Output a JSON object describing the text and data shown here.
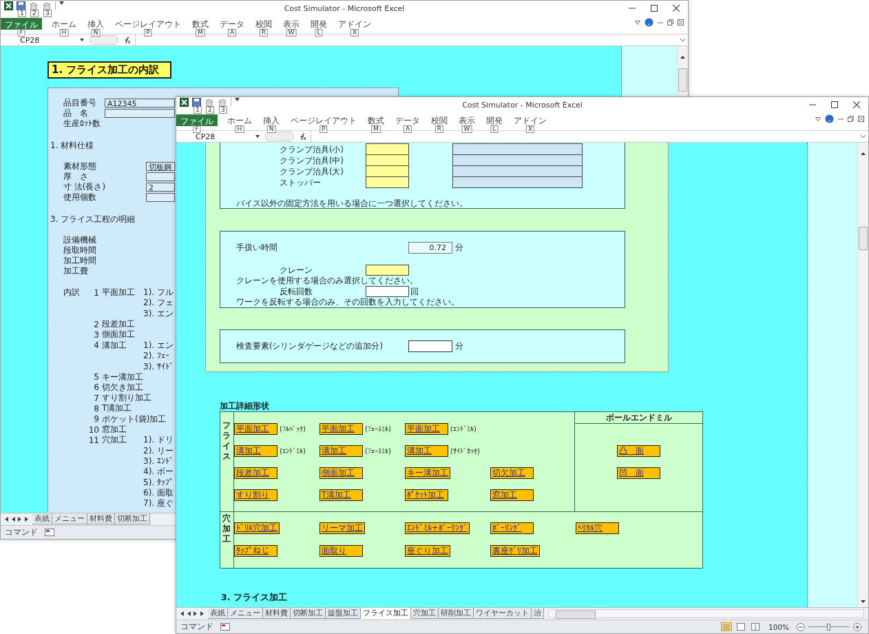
{
  "windows": [
    {
      "kind": "breakdown",
      "title": "Cost Simulator - Microsoft Excel",
      "quick_access_keys": [
        "1",
        "2",
        "3"
      ],
      "ribbon_tabs": [
        {
          "label": "ファイル",
          "key": "F",
          "kind": "file"
        },
        {
          "label": "ホーム",
          "key": "H",
          "kind": "tab"
        },
        {
          "label": "挿入",
          "key": "N",
          "kind": "tab"
        },
        {
          "label": "ページレイアウト",
          "key": "P",
          "kind": "tab"
        },
        {
          "label": "数式",
          "key": "M",
          "kind": "tab"
        },
        {
          "label": "データ",
          "key": "A",
          "kind": "tab"
        },
        {
          "label": "校閲",
          "key": "R",
          "kind": "tab"
        },
        {
          "label": "表示",
          "key": "W",
          "kind": "tab"
        },
        {
          "label": "開発",
          "key": "L",
          "kind": "tab"
        },
        {
          "label": "アドイン",
          "key": "X",
          "kind": "tab"
        }
      ],
      "name_box": "CP28",
      "heading": "1. フライス加工の内訳",
      "rows": [
        {
          "kind": "id-field",
          "label": "品目番号",
          "value": "A12345"
        },
        {
          "kind": "id-field",
          "label": "品　名"
        },
        {
          "kind": "label",
          "label": "生産ﾛｯﾄ数"
        },
        {
          "kind": "section",
          "label": "1. 材料仕様"
        },
        {
          "kind": "spec-field",
          "label": "素材形態",
          "value": "切板鋼"
        },
        {
          "kind": "spec-field",
          "label": "厚　さ"
        },
        {
          "kind": "spec-field",
          "label": "寸 法(長さ)",
          "value": "2"
        },
        {
          "kind": "spec-field",
          "label": "使用個数"
        },
        {
          "kind": "section",
          "label": "3. フライス工程の明細"
        },
        {
          "kind": "label",
          "label": "設備機械"
        },
        {
          "kind": "label",
          "label": "段取時間"
        },
        {
          "kind": "label",
          "label": "加工時間"
        },
        {
          "kind": "label",
          "label": "加工費"
        },
        {
          "kind": "breakdown",
          "caption": "内訳",
          "number": "1",
          "name": "平面加工",
          "sub": "1). フル"
        },
        {
          "kind": "breakdown",
          "sub": "2). フェ"
        },
        {
          "kind": "breakdown",
          "sub": "3). エン"
        },
        {
          "kind": "breakdown",
          "number": "2",
          "name": "段差加工"
        },
        {
          "kind": "breakdown",
          "number": "3",
          "name": "側面加工"
        },
        {
          "kind": "breakdown",
          "number": "4",
          "name": "溝加工",
          "sub": "1). エン"
        },
        {
          "kind": "breakdown",
          "sub": "2). ﾌｪｰ"
        },
        {
          "kind": "breakdown",
          "sub": "3). ｻｲﾄﾞ"
        },
        {
          "kind": "breakdown",
          "number": "5",
          "name": "キー溝加工"
        },
        {
          "kind": "breakdown",
          "number": "6",
          "name": "切欠き加工"
        },
        {
          "kind": "breakdown",
          "number": "7",
          "name": "すり割り加工"
        },
        {
          "kind": "breakdown",
          "number": "8",
          "name": "T溝加工"
        },
        {
          "kind": "breakdown",
          "number": "9",
          "name": "ポケット(袋)加工"
        },
        {
          "kind": "breakdown",
          "number": "10",
          "name": "窓加工"
        },
        {
          "kind": "breakdown",
          "number": "11",
          "name": "穴加工",
          "sub": "1). ドリ"
        },
        {
          "kind": "breakdown",
          "sub": "2). リー"
        },
        {
          "kind": "breakdown",
          "sub": "3). ｴﾝﾄﾞ"
        },
        {
          "kind": "breakdown",
          "sub": "4). ボー"
        },
        {
          "kind": "breakdown",
          "sub": "5). ﾀｯﾌﾟ"
        },
        {
          "kind": "breakdown",
          "sub": "6). 面取"
        },
        {
          "kind": "breakdown",
          "sub": "7). 座ぐ"
        }
      ],
      "sheet_tabs": [
        {
          "label": "表紙",
          "selected": false
        },
        {
          "label": "メニュー",
          "selected": false
        },
        {
          "label": "材料費",
          "selected": false
        },
        {
          "label": "切断加工",
          "selected": false
        }
      ],
      "status": "コマンド"
    },
    {
      "kind": "form",
      "title": "Cost Simulator - Microsoft Excel",
      "quick_access_keys": [
        "1",
        "2",
        "3"
      ],
      "ribbon_tabs": [
        {
          "label": "ファイル",
          "key": "F",
          "kind": "file"
        },
        {
          "label": "ホーム",
          "key": "H",
          "kind": "tab"
        },
        {
          "label": "挿入",
          "key": "N",
          "kind": "tab"
        },
        {
          "label": "ページレイアウト",
          "key": "P",
          "kind": "tab"
        },
        {
          "label": "数式",
          "key": "M",
          "kind": "tab"
        },
        {
          "label": "データ",
          "key": "A",
          "kind": "tab"
        },
        {
          "label": "校閲",
          "key": "R",
          "kind": "tab"
        },
        {
          "label": "表示",
          "key": "W",
          "kind": "tab"
        },
        {
          "label": "開発",
          "key": "L",
          "kind": "tab"
        },
        {
          "label": "アドイン",
          "key": "X",
          "kind": "tab"
        }
      ],
      "name_box": "CP28",
      "clamp_rows": [
        {
          "label": "クランプ治具(小)"
        },
        {
          "label": "クランプ治具(中)"
        },
        {
          "label": "クランプ治具(大)"
        },
        {
          "label": "ストッパー"
        }
      ],
      "clamp_note": "バイス以外の固定方法を用いる場合に一つ選択してください。",
      "handling": {
        "label": "手扱い時間",
        "value": "0.72",
        "unit": "分",
        "crane_label": "クレーン",
        "crane_note": "クレーンを使用する場合のみ選択してください。",
        "flip_label": "反転回数",
        "flip_unit": "回",
        "flip_note": "ワークを反転する場合のみ、その回数を入力してください。"
      },
      "inspection": {
        "label": "検査要素(シリンダゲージなどの追加分)",
        "unit": "分"
      },
      "shape_table": {
        "title": "加工詳細形状",
        "sections": [
          {
            "label": "フライス",
            "rows": [
              [
                {
                  "button": "平面加工",
                  "note": "(ﾌﾙﾊﾞｯｸ)"
                },
                {
                  "button": "平面加工",
                  "note": "(ﾌｪｰｽﾐﾙ)"
                },
                {
                  "button": "平面加工",
                  "note": "(ｴﾝﾄﾞﾐﾙ)"
                }
              ],
              [
                {
                  "button": "溝加工",
                  "note": "(ｴﾝﾄﾞﾐﾙ)"
                },
                {
                  "button": "溝加工",
                  "note": "(ﾌｪｰｽﾐﾙ)"
                },
                {
                  "button": "溝加工",
                  "note": "(ｻｲﾄﾞｶｯﾀ)"
                }
              ],
              [
                {
                  "button": "段差加工"
                },
                {
                  "button": "側面加工"
                },
                {
                  "button": "キー溝加工"
                },
                {
                  "button": "切欠加工"
                }
              ],
              [
                {
                  "button": "すり割り"
                },
                {
                  "button": "T溝加工"
                },
                {
                  "button": "ﾎﾟｹｯﾄ加工"
                },
                {
                  "button": "窓加工"
                }
              ]
            ],
            "side": {
              "title": "ボールエンドミル",
              "buttons": [
                "凸　面",
                "凹　面"
              ]
            }
          },
          {
            "label": "穴加工",
            "rows": [
              [
                {
                  "button": "ﾄﾞﾘﾙ穴加工"
                },
                {
                  "button": "リーマ加工"
                },
                {
                  "button": "ｴﾝﾄﾞﾐﾙ+ﾎﾞｰﾘﾝｸﾞ"
                },
                {
                  "button": "ﾎﾞｰﾘﾝｸﾞ"
                },
                {
                  "button": "ﾍﾘｶﾙ穴"
                }
              ],
              [
                {
                  "button": "ﾀｯﾌﾟねじ"
                },
                {
                  "button": "面取り"
                },
                {
                  "button": "座ぐり加工"
                },
                {
                  "button": "裏座ｸﾞﾘ加工"
                }
              ]
            ]
          }
        ]
      },
      "section_3": "3. フライス加工",
      "sheet_tabs": [
        {
          "label": "表紙",
          "selected": false
        },
        {
          "label": "メニュー",
          "selected": false
        },
        {
          "label": "材料費",
          "selected": false
        },
        {
          "label": "切断加工",
          "selected": false
        },
        {
          "label": "旋盤加工",
          "selected": false
        },
        {
          "label": "フライス加工",
          "selected": true
        },
        {
          "label": "穴加工",
          "selected": false
        },
        {
          "label": "研削加工",
          "selected": false
        },
        {
          "label": "ワイヤーカット",
          "selected": false
        },
        {
          "label": "治",
          "selected": false
        }
      ],
      "status": "コマンド",
      "zoom": "100%",
      "zoom_slider": {
        "level": 0.5
      }
    }
  ]
}
